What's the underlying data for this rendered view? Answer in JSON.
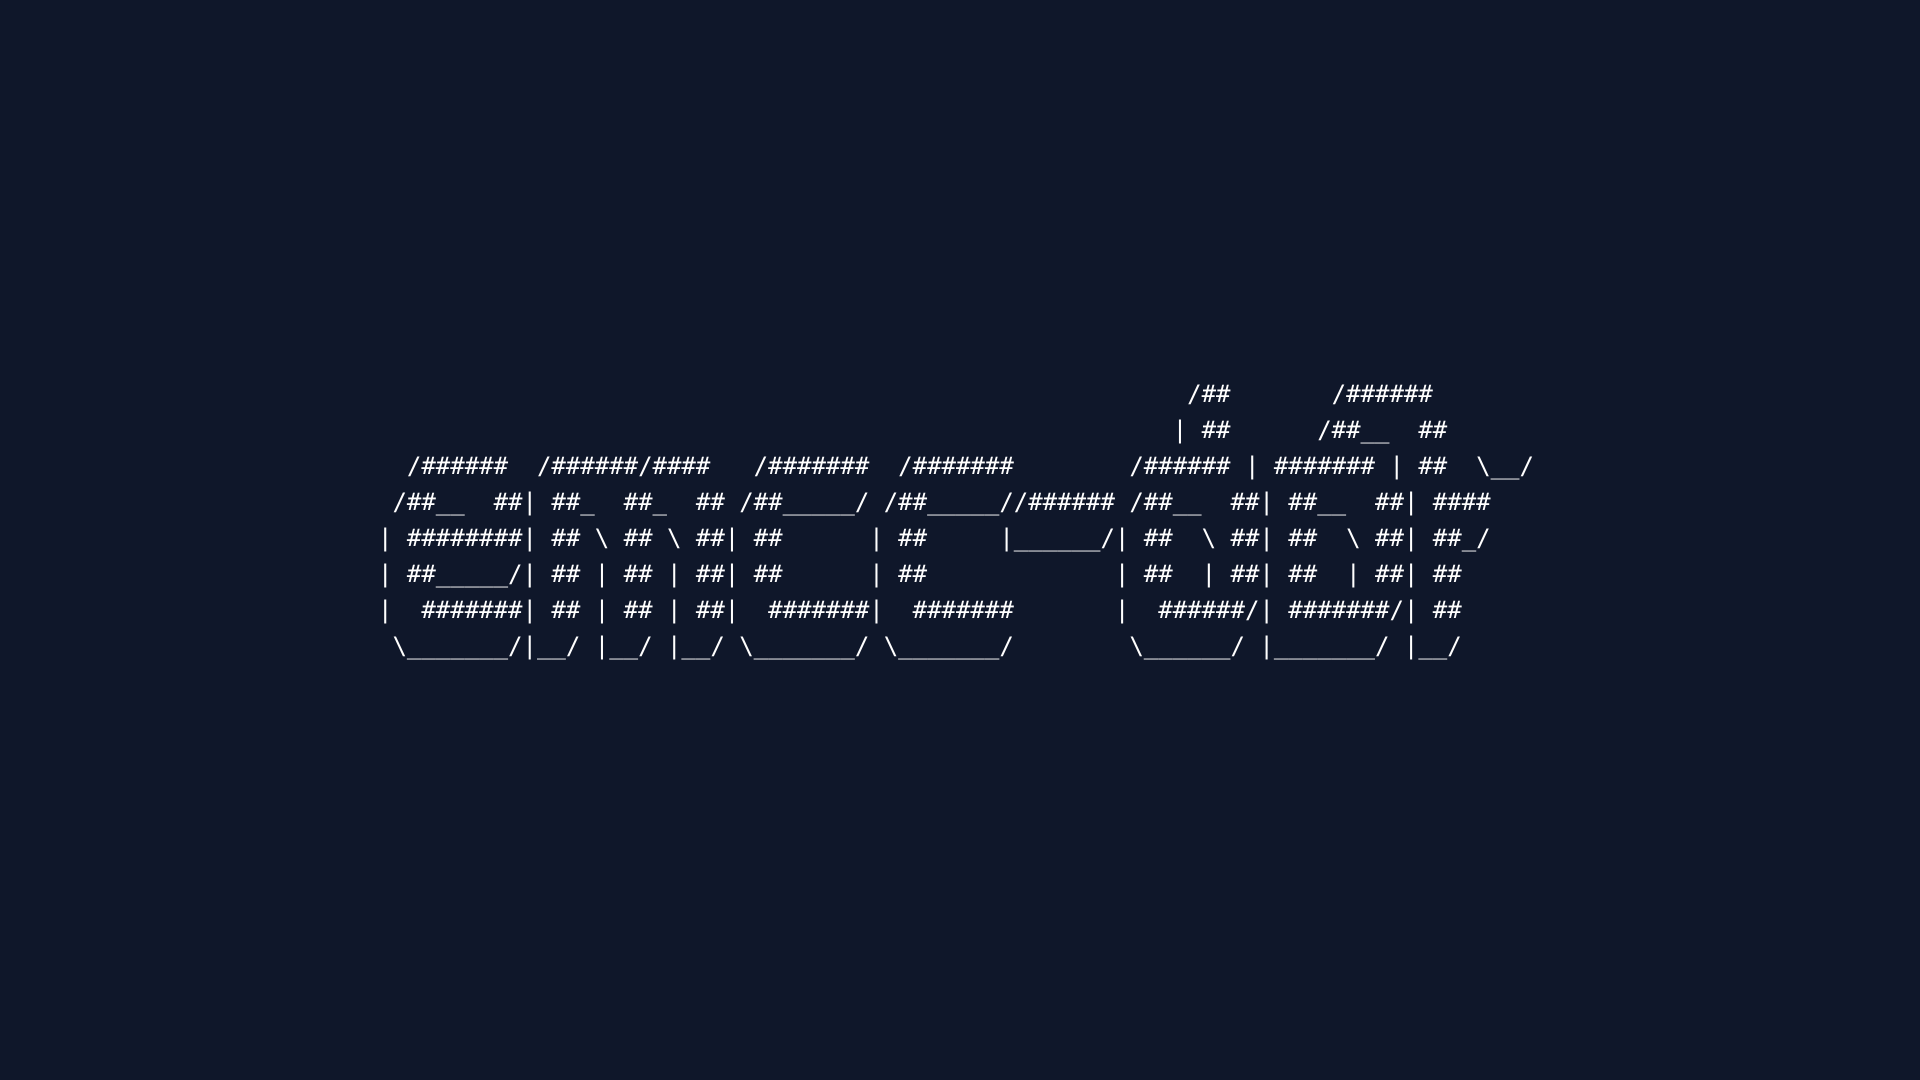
{
  "colors": {
    "background": "#0f172a",
    "text": "#ffffff"
  },
  "banner": {
    "lines": [
      "                                                        /##       /######",
      "                                                       | ##      /##__  ##",
      "  /######  /######/####   /#######  /#######        /###### | ####### | ##  \\__/",
      " /##__  ##| ##_  ##_  ## /##_____/ /##_____//###### /##__  ##| ##__  ##| ####",
      "| ########| ## \\ ## \\ ##| ##      | ##     |______/| ##  \\ ##| ##  \\ ##| ##_/",
      "| ##_____/| ## | ## | ##| ##      | ##             | ##  | ##| ##  | ##| ##",
      "|  #######| ## | ## | ##|  #######|  #######       |  ######/| #######/| ##",
      " \\_______/|__/ |__/ |__/ \\_______/ \\_______/        \\______/ |_______/ |__/"
    ]
  }
}
